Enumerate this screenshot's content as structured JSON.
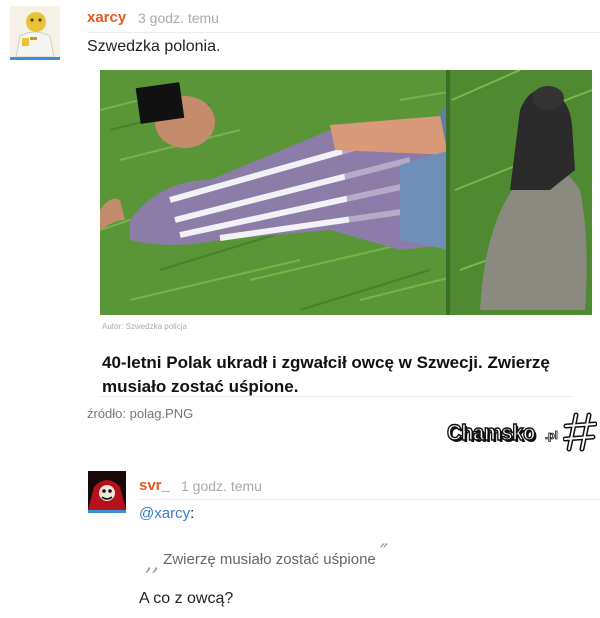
{
  "comment1": {
    "username": "xarcy",
    "time": "3 godz. temu",
    "text": "Szwedzka polonia.",
    "attachment": {
      "credit": "Autor: Szwedzka policja",
      "headline": "40-letni Polak ukradł i zgwałcił owcę w Szwecji. Zwierzę musiało zostać uśpione."
    },
    "source": "źródło: polag.PNG"
  },
  "watermark": {
    "text": "Chamsko",
    "suffix": ".pl"
  },
  "comment2": {
    "username": "svr_",
    "time": "1 godz. temu",
    "mention_prefix": "@",
    "mention_user": "xarcy",
    "mention_suffix": ":",
    "quote": "Zwierzę musiało zostać uśpione",
    "text": "A co z owcą?"
  },
  "colors": {
    "username": "#e8581e",
    "link": "#3a7dc9",
    "avatar_underline": "#3d8ed9"
  }
}
